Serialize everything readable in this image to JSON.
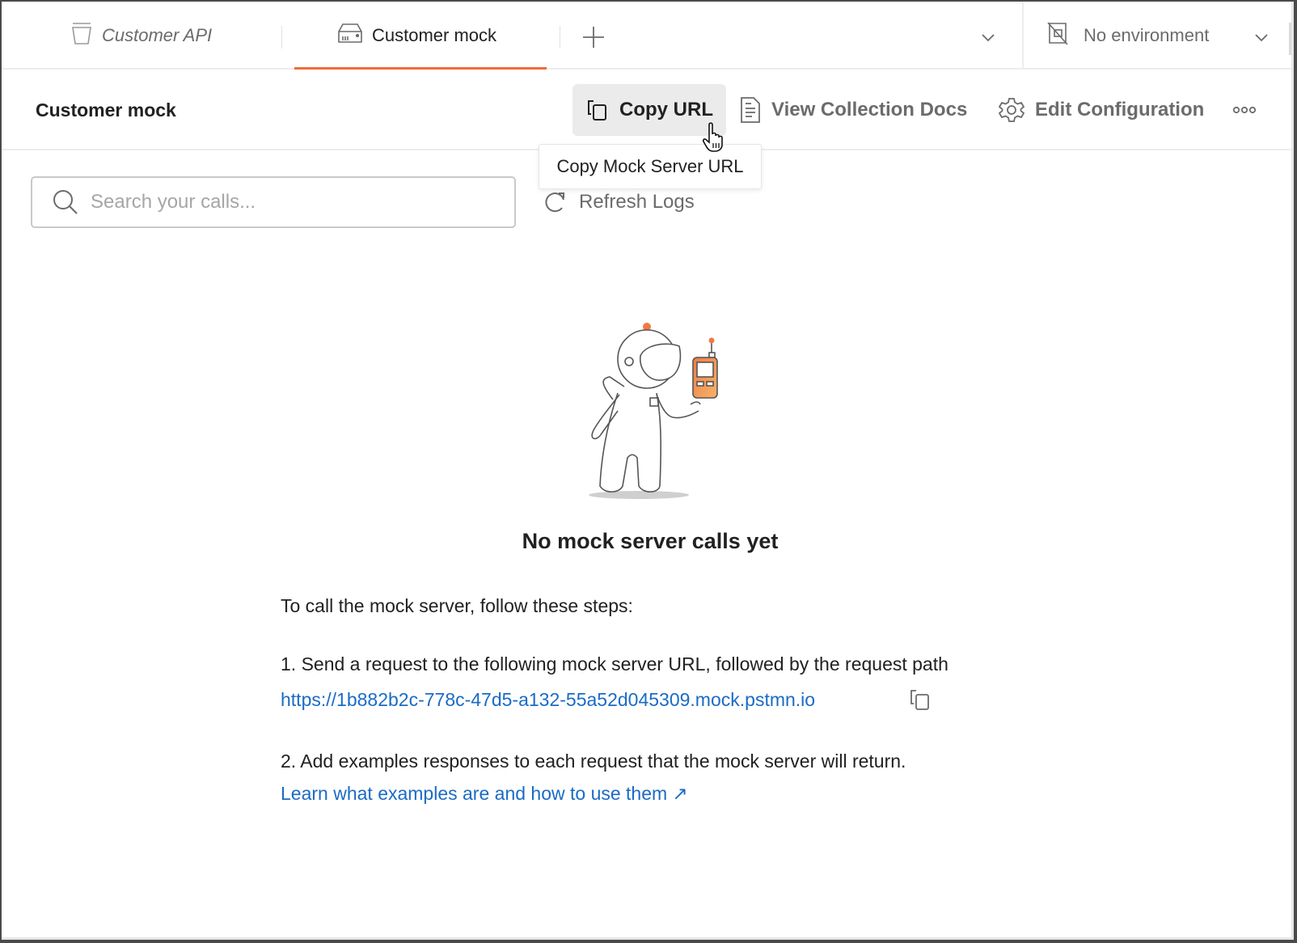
{
  "tabs": [
    {
      "label": "Customer API",
      "icon": "collection-icon",
      "active": false
    },
    {
      "label": "Customer mock",
      "icon": "mock-server-icon",
      "active": true
    }
  ],
  "new_tab_icon": "plus-icon",
  "tabs_menu_icon": "chevron-down-icon",
  "environment": {
    "label": "No environment",
    "icon": "no-environment-icon",
    "dropdown_icon": "chevron-down-icon"
  },
  "header": {
    "title": "Customer mock",
    "actions": {
      "copy_url": "Copy URL",
      "view_docs": "View Collection Docs",
      "edit_config": "Edit Configuration",
      "more": "more-options"
    },
    "tooltip": "Copy Mock Server URL"
  },
  "search": {
    "placeholder": "Search your calls...",
    "value": ""
  },
  "refresh_label": "Refresh Logs",
  "empty_state": {
    "title": "No mock server calls yet",
    "intro": "To call the mock server, follow these steps:",
    "step1": "1. Send a request to the following mock server URL, followed by the request path",
    "mock_url": "https://1b882b2c-778c-47d5-a132-55a52d045309.mock.pstmn.io",
    "step2": "2. Add examples responses to each request that the mock server will return.",
    "learn_link": "Learn what examples are and how to use them ↗"
  },
  "colors": {
    "accent": "#ef6c3a",
    "link": "#1a6bc6",
    "text": "#212121",
    "muted": "#6b6b6b"
  }
}
